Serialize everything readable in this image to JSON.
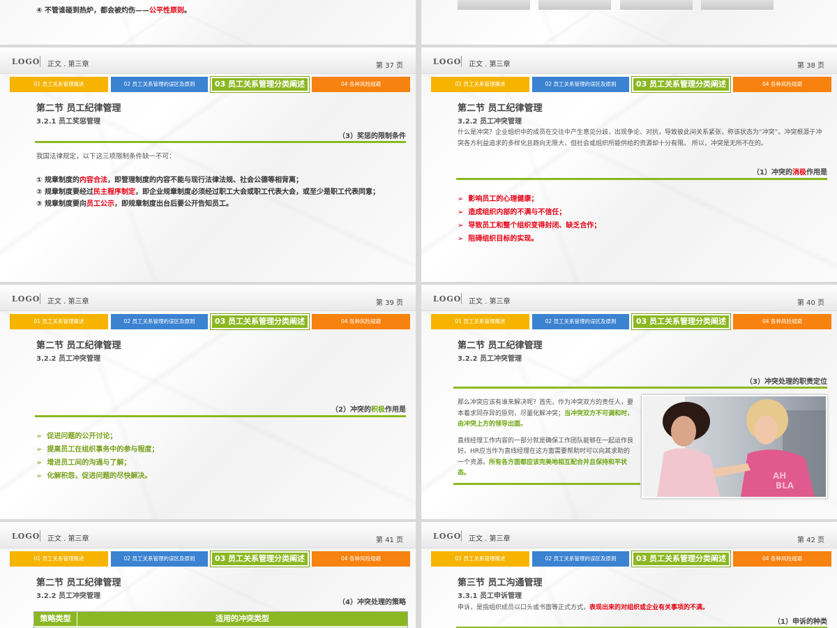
{
  "header": {
    "logo": "LOGO",
    "chapter": "正文 . 第三章"
  },
  "tabs": [
    "01 员工关系管理概述",
    "02 员工关系管理的误区及原则",
    "03 员工关系管理分类阐述",
    "04 各种风险规避"
  ],
  "top_left": {
    "num": "④",
    "text_a": "不管谁碰到热炉，都会被灼伤——",
    "text_hl": "公平性原则",
    "text_b": "。"
  },
  "s37": {
    "page": "第 37 页",
    "section": "第二节  员工纪律管理",
    "sub": "3.2.1 员工奖惩管理",
    "right_title": "（3）奖惩的限制条件",
    "intro": "我国法律规定，以下这三项限制条件缺一不可：",
    "i1": {
      "num": "①",
      "a": "规章制度的",
      "hl": "内容合法",
      "b": "，即管理制度的内容不能与现行法律法规、社会公德等相背离；"
    },
    "i2": {
      "num": "②",
      "a": "规章制度要经过",
      "hl": "民主程序制定",
      "b": "，即企业规章制度必须经过职工大会或职工代表大会，或至少是职工代表同意；"
    },
    "i3": {
      "num": "③",
      "a": "规章制度要向",
      "hl": "员工公示",
      "b": "，即规章制度出台后要公开告知员工。"
    }
  },
  "s38": {
    "page": "第 38 页",
    "section": "第二节  员工纪律管理",
    "sub": "3.2.2 员工冲突管理",
    "para": "什么是冲突？企业组织中的成员在交往中产生意见分歧，出现争论、对抗，导致彼此间关系紧张，称该状态为“冲突”。冲突根源于冲突各方利益追求的多样化且趋向无限大，但社会或组织所能供给的资源却十分有限。 所以，冲突是无所不在的。",
    "right_a": "（1）冲突的",
    "right_hl": "消极",
    "right_b": "作用是",
    "list": [
      "影响员工的心理健康；",
      "造成组织内部的不满与不信任；",
      "导致员工和整个组织变得封闭、缺乏合作；",
      "阻碍组织目标的实现。"
    ]
  },
  "s39": {
    "page": "第 39 页",
    "section": "第二节  员工纪律管理",
    "sub": "3.2.2 员工冲突管理",
    "right_a": "（2）冲突的",
    "right_hl": "积极",
    "right_b": "作用是",
    "list": [
      "促进问题的公开讨论；",
      "提高员工在组织事务中的参与程度；",
      "增进员工间的沟通与了解；",
      "化解积怨，促进问题的尽快解决。"
    ]
  },
  "s40": {
    "page": "第 40 页",
    "section": "第二节  员工纪律管理",
    "sub": "3.2.2 员工冲突管理",
    "right_title": "（3）冲突处理的职责定位",
    "p1_a": "那么冲突应该有谁来解决呢？首先，作为冲突双方的责任人，要本着求同存异的原则，尽量化解冲突；",
    "p1_hl": "当冲突双方不可调和时，由冲突上方的领导出面。",
    "p2_a": "直线经理工作内容的一部分就是确保工作团队能够在一起运作良好。HR应当作为直线经理在这方面需要帮助时可以向其求助的一个资源。",
    "p2_hl": "所有各方面都应该完美地相互配合并且保持和平状态。"
  },
  "s41": {
    "page": "第 41 页",
    "section": "第二节  员工纪律管理",
    "sub": "3.2.2 员工冲突管理",
    "right_title": "（4）冲突处理的策略",
    "col1": "策略类型",
    "col2": "适用的冲突类型"
  },
  "s42": {
    "page": "第 42 页",
    "section": "第三节  员工沟通管理",
    "sub": "3.3.1 员工申诉管理",
    "para_a": "申诉，是指组织成员以口头或书面等正式方式，",
    "para_hl": "表现出来的对组织或企业有关事项的不满。",
    "right_title": "（1）申诉的种类"
  }
}
